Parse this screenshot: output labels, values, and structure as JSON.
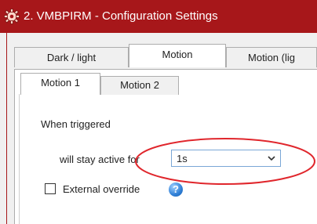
{
  "window": {
    "title": "2. VMBPIRM - Configuration Settings"
  },
  "tabs": [
    {
      "label": "Dark / light"
    },
    {
      "label": "Motion",
      "active": true
    },
    {
      "label": "Motion (lig"
    }
  ],
  "subtabs": [
    {
      "label": "Motion 1",
      "active": true
    },
    {
      "label": "Motion 2"
    }
  ],
  "form": {
    "section_label": "When triggered",
    "stay_active_label": "will stay active for",
    "stay_active_value": "1s",
    "external_override_label": "External override",
    "external_override_checked": false
  },
  "icons": {
    "title": "gear-icon",
    "dropdown": "chevron-down-icon",
    "help": "help-icon"
  },
  "colors": {
    "titlebar": "#a7171a",
    "highlight_ellipse": "#e0262c",
    "combo_border": "#7aa7d6"
  }
}
